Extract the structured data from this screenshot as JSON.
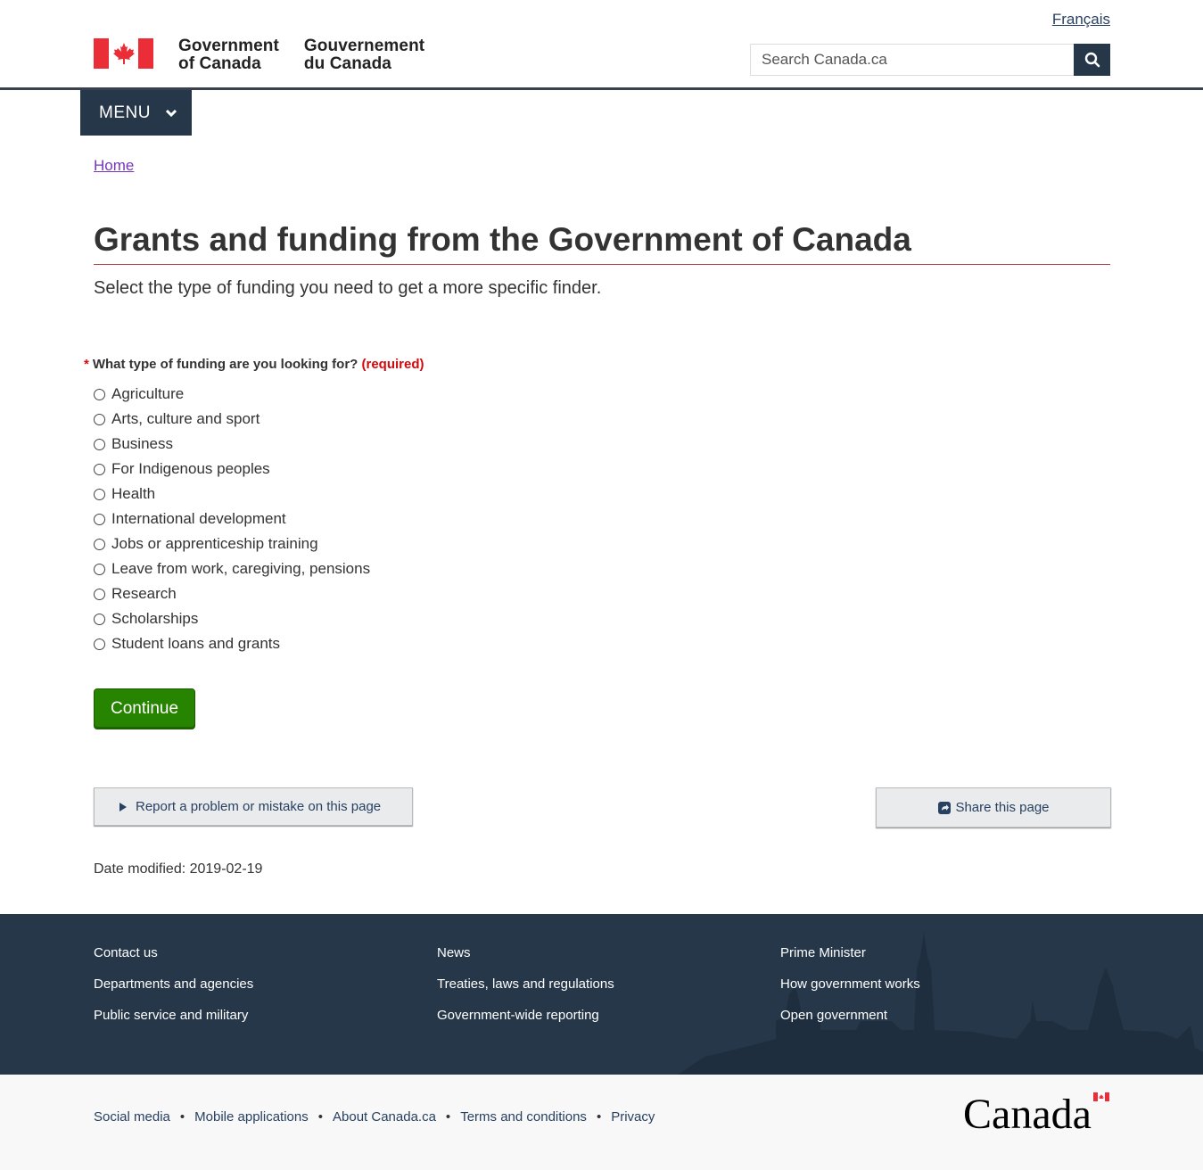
{
  "header": {
    "language_link": "Français",
    "brand_en_line1": "Government",
    "brand_en_line2": "of Canada",
    "brand_fr_line1": "Gouvernement",
    "brand_fr_line2": "du Canada",
    "search_placeholder": "Search Canada.ca",
    "search_button_icon": "search-icon"
  },
  "menu": {
    "label": "MENU"
  },
  "breadcrumb": {
    "home": "Home"
  },
  "main": {
    "title": "Grants and funding from the Government of Canada",
    "lead": "Select the type of funding you need to get a more specific finder.",
    "question": {
      "asterisk": "*",
      "label": "What type of funding are you looking for?",
      "required": "(required)",
      "options": [
        "Agriculture",
        "Arts, culture and sport",
        "Business",
        "For Indigenous peoples",
        "Health",
        "International development",
        "Jobs or apprenticeship training",
        "Leave from work, caregiving, pensions",
        "Research",
        "Scholarships",
        "Student loans and grants"
      ]
    },
    "continue_label": "Continue",
    "report_label": "Report a problem or mistake on this page",
    "share_label": "Share this page",
    "date_modified": "Date modified: 2019-02-19"
  },
  "footer": {
    "col1": [
      "Contact us",
      "Departments and agencies",
      "Public service and military"
    ],
    "col2": [
      "News",
      "Treaties, laws and regulations",
      "Government-wide reporting"
    ],
    "col3": [
      "Prime Minister",
      "How government works",
      "Open government"
    ],
    "sub_links": [
      "Social media",
      "Mobile applications",
      "About Canada.ca",
      "Terms and conditions",
      "Privacy"
    ],
    "wordmark": "Canada"
  },
  "colors": {
    "navy": "#26374a",
    "flag_red": "#eb2d37",
    "continue_green": "#278400",
    "required_red": "#d3080c",
    "visited_link": "#7834bc"
  }
}
